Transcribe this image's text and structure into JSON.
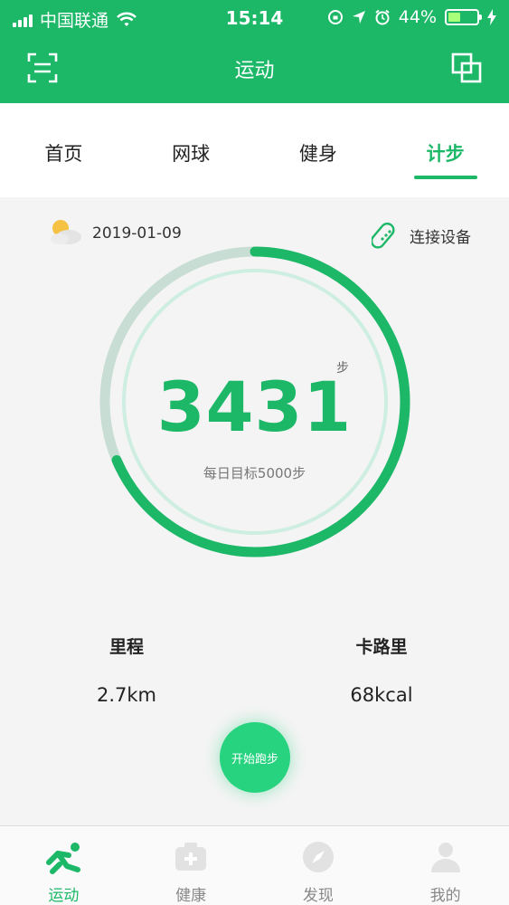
{
  "status_bar": {
    "carrier": "中国联通",
    "time": "15:14",
    "battery": "44%",
    "battery_level": 0.44
  },
  "header": {
    "title": "运动",
    "scan_icon": "scan-icon",
    "multi_window_icon": "multi-window-icon"
  },
  "tabs": [
    {
      "label": "首页",
      "active": false
    },
    {
      "label": "网球",
      "active": false
    },
    {
      "label": "健身",
      "active": false
    },
    {
      "label": "计步",
      "active": true
    }
  ],
  "info": {
    "weather_icon": "partly-cloudy-icon",
    "date": "2019-01-09",
    "connect_label": "连接设备",
    "connect_icon": "wristband-icon"
  },
  "pedometer": {
    "steps": "3431",
    "unit": "步",
    "goal_text": "每日目标5000步",
    "steps_value": 3431,
    "goal_value": 5000
  },
  "stats": {
    "distance_label": "里程",
    "distance_value": "2.7km",
    "calories_label": "卡路里",
    "calories_value": "68kcal"
  },
  "start_button": {
    "label": "开始跑步"
  },
  "bottom_nav": [
    {
      "label": "运动",
      "icon": "running-icon",
      "active": true
    },
    {
      "label": "健康",
      "icon": "medical-kit-icon",
      "active": false
    },
    {
      "label": "发现",
      "icon": "compass-icon",
      "active": false
    },
    {
      "label": "我的",
      "icon": "profile-icon",
      "active": false
    }
  ],
  "colors": {
    "brand_green": "#1cb868",
    "ring_inner": "#cdeee0",
    "ring_track": "#c8ddd4",
    "start_button": "#28d380"
  }
}
